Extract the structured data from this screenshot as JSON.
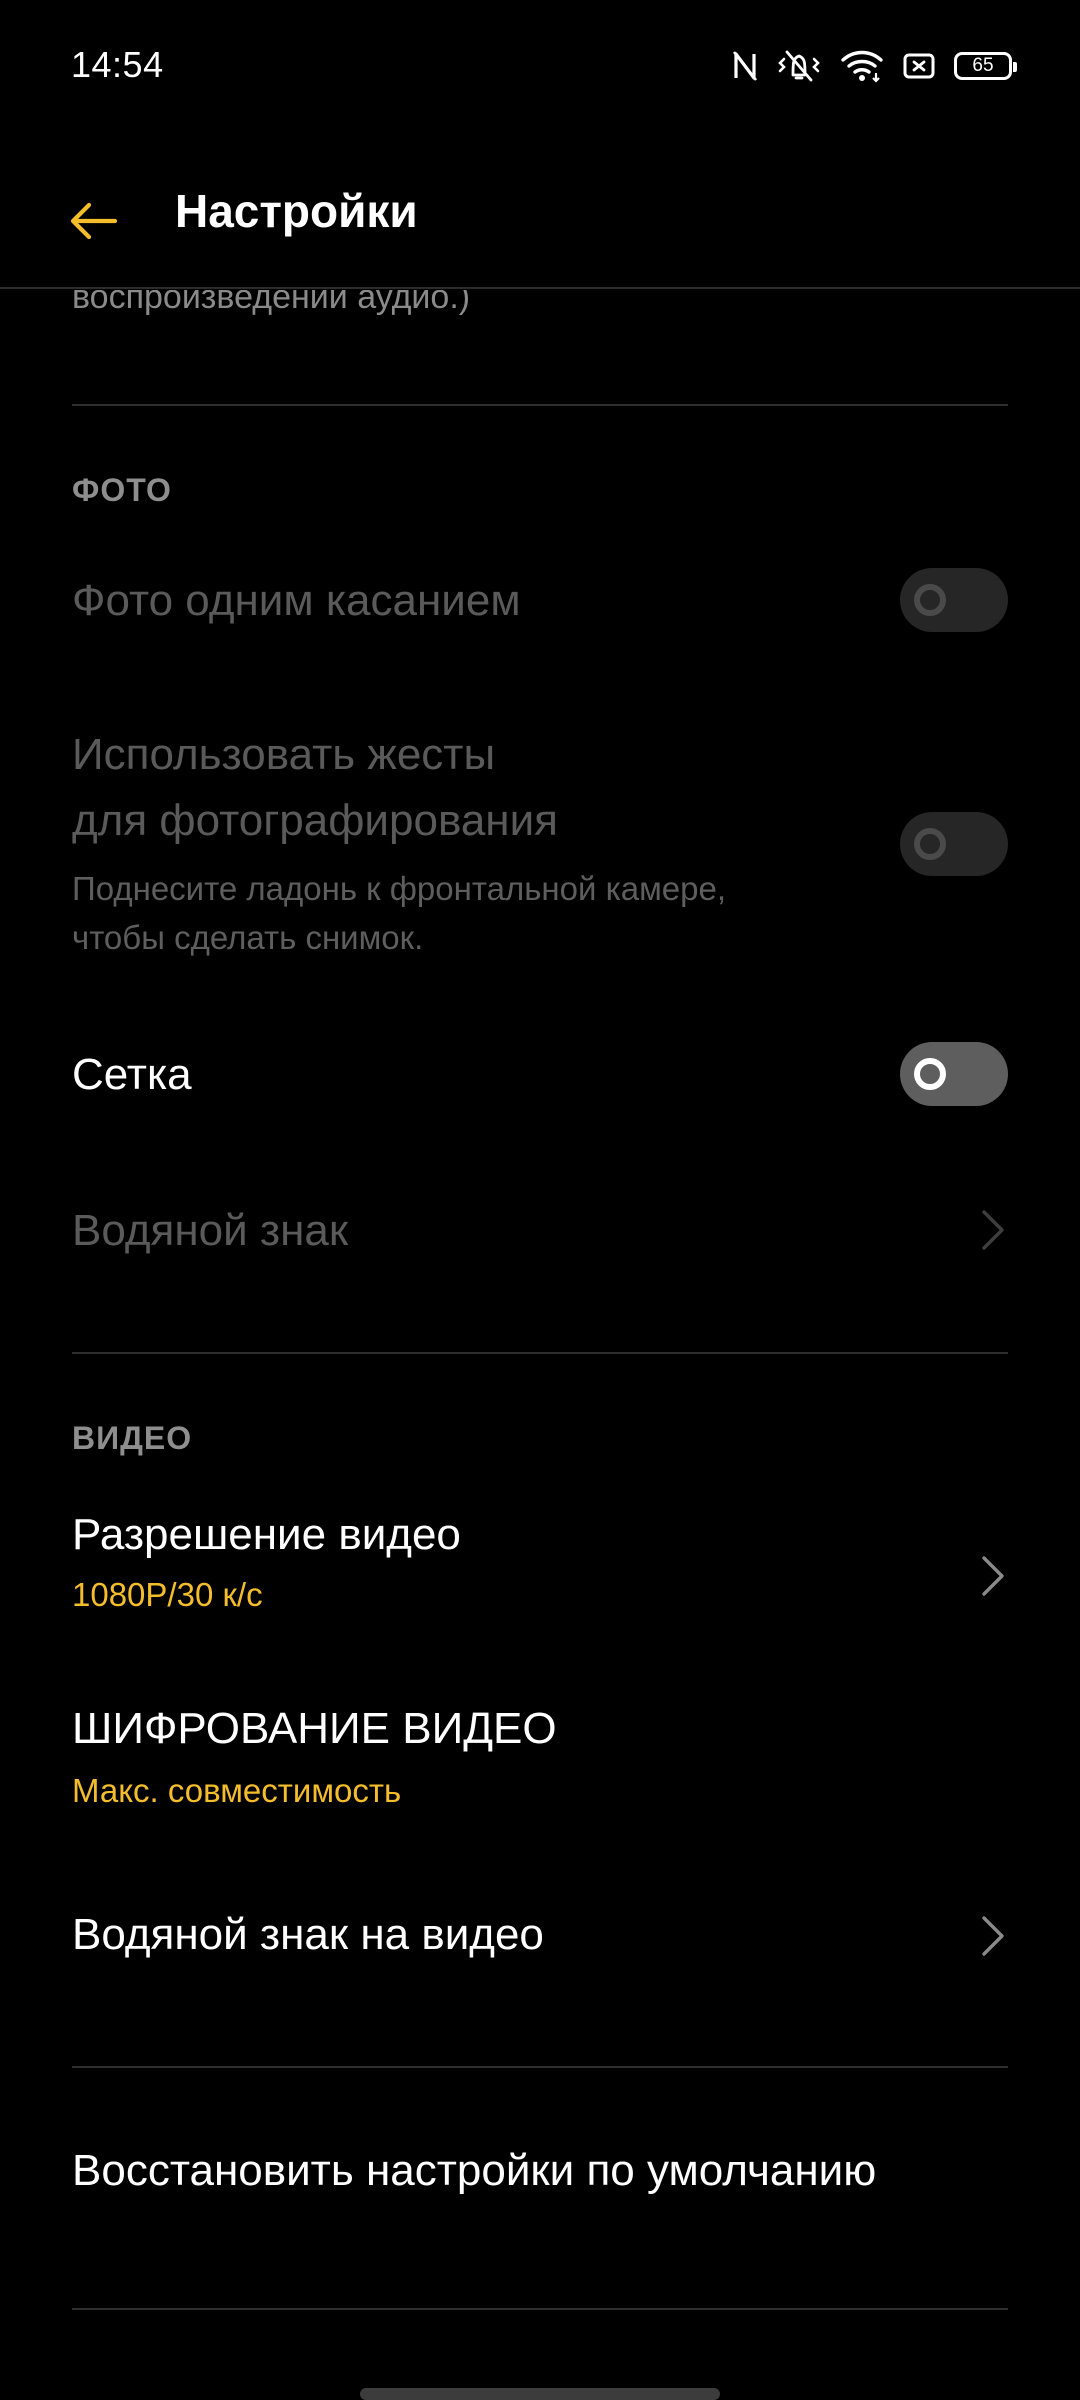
{
  "status_bar": {
    "time": "14:54",
    "battery_level": "65",
    "icons": [
      "nfc-icon",
      "mute-vibrate-icon",
      "wifi-icon",
      "sim-icon",
      "battery-icon"
    ]
  },
  "header": {
    "title": "Настройки",
    "back_icon": "arrow-left-icon"
  },
  "clipped_description": "воспроизведении аудио.)",
  "sections": {
    "photo": {
      "header": "ФОТО",
      "items": {
        "one_touch_photo": {
          "title": "Фото одним касанием",
          "enabled": false,
          "checked": false
        },
        "gesture_photo": {
          "title_line1": "Использовать жесты",
          "title_line2": "для фотографирования",
          "sub_line1": "Поднесите ладонь к фронтальной камере,",
          "sub_line2": "чтобы сделать снимок.",
          "enabled": false,
          "checked": false
        },
        "grid": {
          "title": "Сетка",
          "enabled": true,
          "checked": false
        },
        "watermark": {
          "title": "Водяной знак",
          "enabled": false
        }
      }
    },
    "video": {
      "header": "ВИДЕО",
      "items": {
        "resolution": {
          "title": "Разрешение видео",
          "value": "1080P/30 к/с"
        },
        "encoding": {
          "title": "ШИФРОВАНИЕ ВИДЕО",
          "value": "Макс. совместимость"
        },
        "video_watermark": {
          "title": "Водяной знак на видео"
        }
      }
    }
  },
  "reset": {
    "title": "Восстановить настройки по умолчанию"
  },
  "colors": {
    "accent": "#f4bd2c",
    "background": "#000000",
    "text_primary": "#ffffff",
    "text_disabled": "#5a5a5a",
    "section_header": "#8e8e8e"
  }
}
